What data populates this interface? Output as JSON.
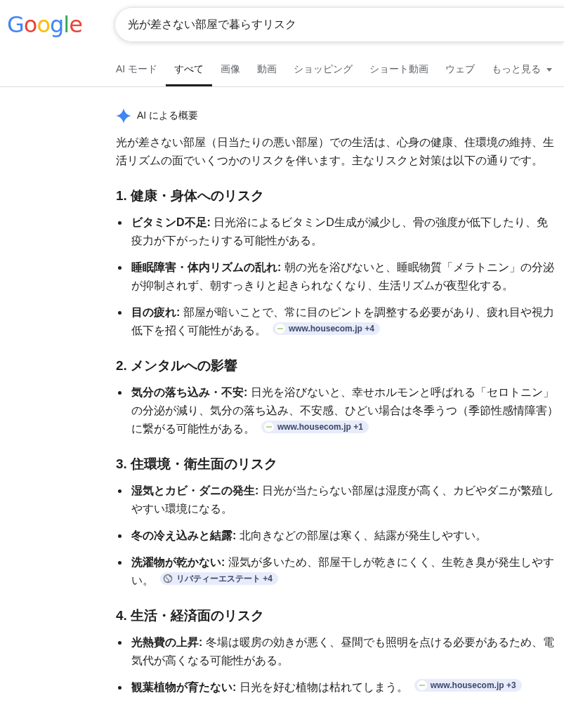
{
  "logo": "Google",
  "search": {
    "value": "光が差さない部屋で暮らすリスク"
  },
  "tabs": [
    {
      "label": "AI モード",
      "selected": false
    },
    {
      "label": "すべて",
      "selected": true
    },
    {
      "label": "画像",
      "selected": false
    },
    {
      "label": "動画",
      "selected": false
    },
    {
      "label": "ショッピング",
      "selected": false
    },
    {
      "label": "ショート動画",
      "selected": false
    },
    {
      "label": "ウェブ",
      "selected": false
    },
    {
      "label": "もっと見る",
      "selected": false,
      "kind": "dropdown"
    }
  ],
  "overview": {
    "title": "AI による概要",
    "intro": "光が差さない部屋（日当たりの悪い部屋）での生活は、心身の健康、住環境の維持、生活リズムの面でいくつかのリスクを伴います。主なリスクと対策は以下の通りです。",
    "sections": [
      {
        "heading": "1. 健康・身体へのリスク",
        "items": [
          {
            "term": "ビタミンD不足:",
            "text": "日光浴によるビタミンD生成が減少し、骨の強度が低下したり、免疫力が下がったりする可能性がある。"
          },
          {
            "term": "睡眠障害・体内リズムの乱れ:",
            "text": "朝の光を浴びないと、睡眠物質「メラトニン」の分泌が抑制されず、朝すっきりと起きられなくなり、生活リズムが夜型化する。"
          },
          {
            "term": "目の疲れ:",
            "text": "部屋が暗いことで、常に目のピントを調整する必要があり、疲れ目や視力低下を招く可能性がある。",
            "source": {
              "label": "www.housecom.jp +4",
              "kind": "favicon"
            }
          }
        ]
      },
      {
        "heading": "2. メンタルへの影響",
        "items": [
          {
            "term": "気分の落ち込み・不安:",
            "text": "日光を浴びないと、幸せホルモンと呼ばれる「セロトニン」の分泌が減り、気分の落ち込み、不安感、ひどい場合は冬季うつ（季節性感情障害）に繋がる可能性がある。",
            "source": {
              "label": "www.housecom.jp +1",
              "kind": "favicon"
            }
          }
        ]
      },
      {
        "heading": "3. 住環境・衛生面のリスク",
        "items": [
          {
            "term": "湿気とカビ・ダニの発生:",
            "text": "日光が当たらない部屋は湿度が高く、カビやダニが繁殖しやすい環境になる。"
          },
          {
            "term": "冬の冷え込みと結露:",
            "text": "北向きなどの部屋は寒く、結露が発生しやすい。"
          },
          {
            "term": "洗濯物が乾かない:",
            "text": "湿気が多いため、部屋干しが乾きにくく、生乾き臭が発生しやすい。",
            "source": {
              "label": "リバティーエステート +4",
              "kind": "globe"
            }
          }
        ]
      },
      {
        "heading": "4. 生活・経済面のリスク",
        "items": [
          {
            "term": "光熱費の上昇:",
            "text": "冬場は暖房の効きが悪く、昼間でも照明を点ける必要があるため、電気代が高くなる可能性がある。"
          },
          {
            "term": "観葉植物が育たない:",
            "text": "日光を好む植物は枯れてしまう。",
            "source": {
              "label": "www.housecom.jp +3",
              "kind": "favicon"
            }
          }
        ]
      }
    ]
  }
}
